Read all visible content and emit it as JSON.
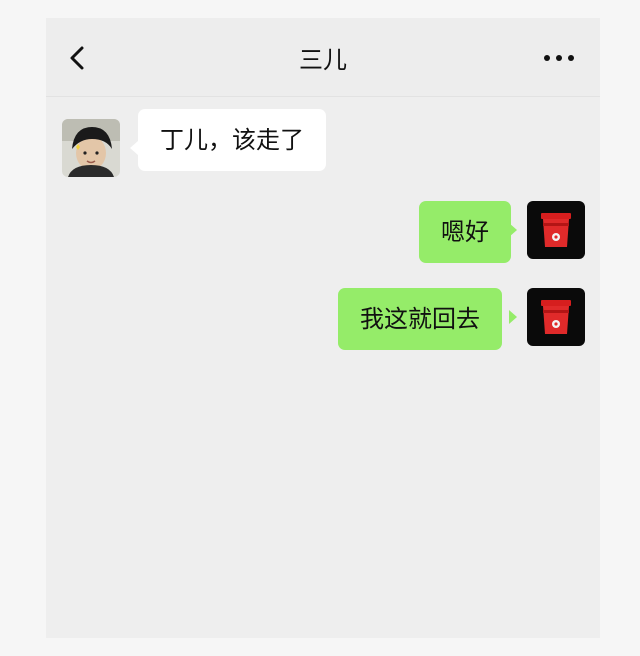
{
  "chat": {
    "title": "三儿",
    "back_icon": "chevron-left-icon",
    "more_icon": "more-dots-icon"
  },
  "messages": [
    {
      "side": "left",
      "text": "丁儿，该走了",
      "avatar": "boy-photo-avatar"
    },
    {
      "side": "right",
      "text": "嗯好",
      "avatar": "red-cup-avatar"
    },
    {
      "side": "right",
      "text": "我这就回去",
      "avatar": "red-cup-avatar"
    }
  ],
  "colors": {
    "background": "#eeeeee",
    "header": "#ededed",
    "incoming_bubble": "#ffffff",
    "outgoing_bubble": "#95ec69"
  }
}
